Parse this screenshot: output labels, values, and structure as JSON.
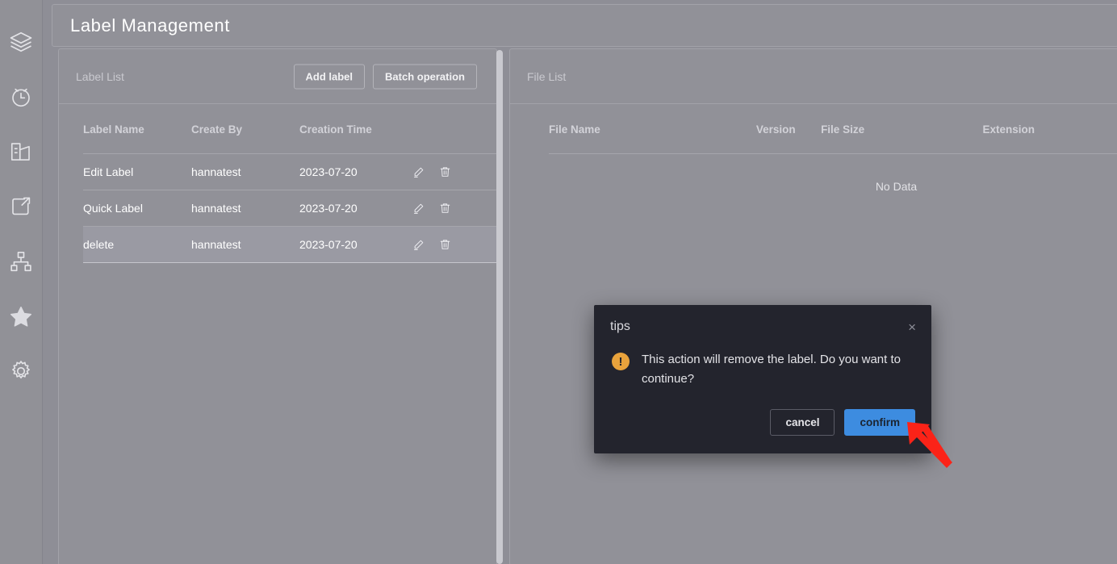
{
  "header": {
    "title": "Label Management"
  },
  "sidebar": {
    "items": [
      {
        "name": "layers-icon",
        "label": "Layers"
      },
      {
        "name": "clock-icon",
        "label": "History"
      },
      {
        "name": "chart-building-icon",
        "label": "Statistics"
      },
      {
        "name": "share-export-icon",
        "label": "Share"
      },
      {
        "name": "sitemap-icon",
        "label": "Structure"
      },
      {
        "name": "star-icon",
        "label": "Favorites"
      },
      {
        "name": "gear-icon",
        "label": "Settings"
      }
    ]
  },
  "label_panel": {
    "title": "Label List",
    "add_button": "Add label",
    "batch_button": "Batch operation",
    "columns": [
      "Label Name",
      "Create By",
      "Creation Time",
      ""
    ],
    "rows": [
      {
        "name": "Edit Label",
        "created_by": "hannatest",
        "created_at": "2023-07-20",
        "selected": false
      },
      {
        "name": "Quick Label",
        "created_by": "hannatest",
        "created_at": "2023-07-20",
        "selected": false
      },
      {
        "name": "delete",
        "created_by": "hannatest",
        "created_at": "2023-07-20",
        "selected": true
      }
    ],
    "row_actions": {
      "edit": "edit-icon",
      "delete": "trash-icon"
    }
  },
  "file_panel": {
    "title": "File List",
    "columns": [
      "File Name",
      "Version",
      "File Size",
      "Extension"
    ],
    "empty_text": "No Data",
    "rows": []
  },
  "dialog": {
    "title": "tips",
    "close_label": "×",
    "icon": "warning-exclamation-icon",
    "icon_glyph": "!",
    "message": "This action will remove the label. Do you want to continue?",
    "cancel_label": "cancel",
    "confirm_label": "confirm"
  },
  "annotation": {
    "arrow_color": "#fb2318",
    "points_to": "confirm-button"
  },
  "colors": {
    "page_background": "#8e8e96",
    "panel_background": "#919198",
    "panel_border": "#a2a2a9",
    "selected_row": "#9a9aa3",
    "dialog_background": "#23242d",
    "confirm_blue": "#3d8ce0",
    "warning_amber": "#e9a33c",
    "arrow_red": "#fb2318"
  }
}
